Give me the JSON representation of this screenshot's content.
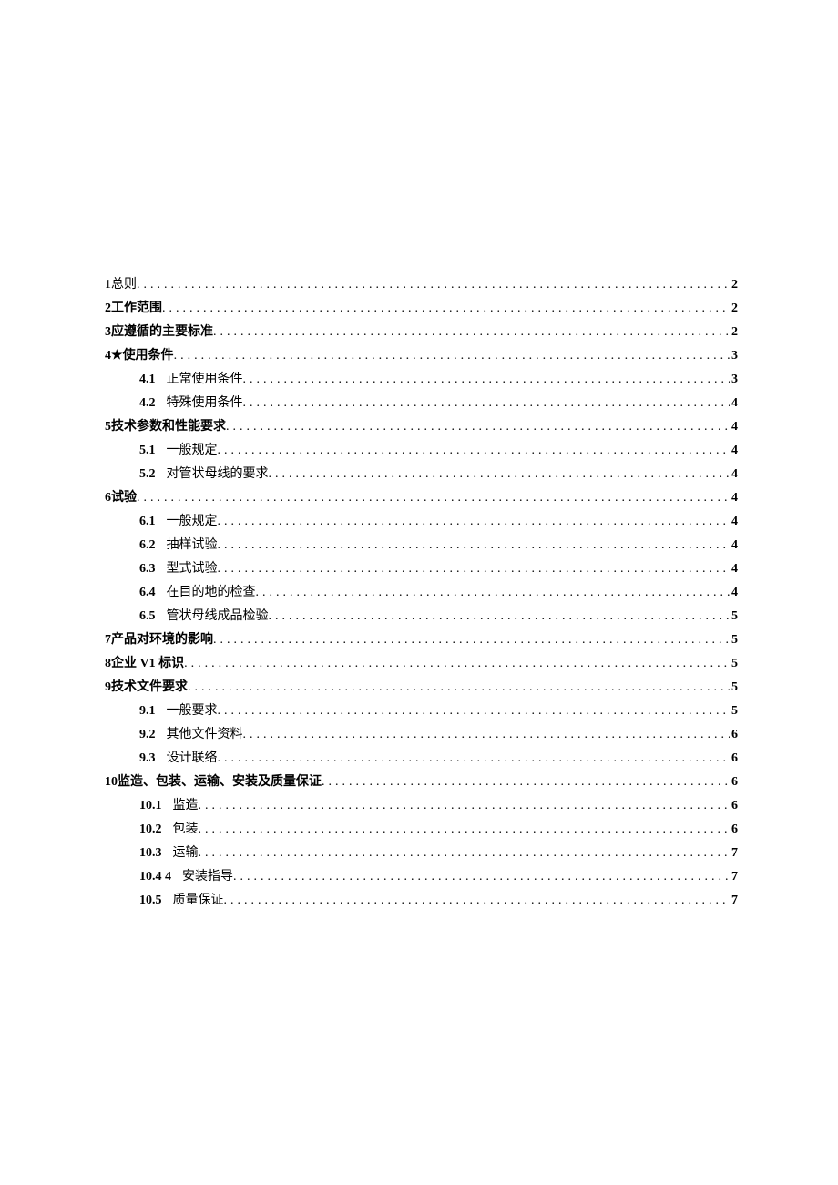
{
  "toc": [
    {
      "level": 1,
      "num": "1",
      "title": "总则",
      "page": "2",
      "bold": false
    },
    {
      "level": 1,
      "num": "2",
      "title": "工作范围",
      "page": "2",
      "bold": true
    },
    {
      "level": 1,
      "num": "3",
      "title": "应遵循的主要标准",
      "page": "2",
      "bold": true
    },
    {
      "level": 1,
      "num": "4★",
      "title": "使用条件",
      "page": "3",
      "bold": true
    },
    {
      "level": 2,
      "num": "4.1",
      "title": "正常使用条件",
      "page": "3"
    },
    {
      "level": 2,
      "num": "4.2",
      "title": "特殊使用条件",
      "page": "4"
    },
    {
      "level": 1,
      "num": "5",
      "title": "技术参数和性能要求",
      "page": "4",
      "bold": true
    },
    {
      "level": 2,
      "num": "5.1",
      "title": "一般规定",
      "page": "4"
    },
    {
      "level": 2,
      "num": "5.2",
      "title": "对管状母线的要求",
      "page": "4"
    },
    {
      "level": 1,
      "num": "6",
      "title": "试验",
      "page": "4",
      "bold": true
    },
    {
      "level": 2,
      "num": "6.1",
      "title": "一般规定",
      "page": "4"
    },
    {
      "level": 2,
      "num": "6.2",
      "title": "抽样试验",
      "page": "4"
    },
    {
      "level": 2,
      "num": "6.3",
      "title": "型式试验",
      "page": "4"
    },
    {
      "level": 2,
      "num": "6.4",
      "title": "在目的地的检查",
      "page": "4"
    },
    {
      "level": 2,
      "num": "6.5",
      "title": "管状母线成品检验",
      "page": "5"
    },
    {
      "level": 1,
      "num": "7",
      "title": "产品对环境的影响",
      "page": "5",
      "bold": true
    },
    {
      "level": 1,
      "num": "8",
      "title": "企业 V1 标识",
      "page": "5",
      "bold": true
    },
    {
      "level": 1,
      "num": "9",
      "title": "技术文件要求",
      "page": "5",
      "bold": true
    },
    {
      "level": 2,
      "num": "9.1",
      "title": "一般要求",
      "page": "5"
    },
    {
      "level": 2,
      "num": "9.2",
      "title": "其他文件资料",
      "page": "6"
    },
    {
      "level": 2,
      "num": "9.3",
      "title": "设计联络",
      "page": "6"
    },
    {
      "level": 1,
      "num": "10",
      "title": "监造、包装、运输、安装及质量保证",
      "page": "6",
      "bold": true
    },
    {
      "level": 2,
      "num": "10.1",
      "title": "监造",
      "page": "6"
    },
    {
      "level": 2,
      "num": "10.2",
      "title": "包装",
      "page": "6"
    },
    {
      "level": 2,
      "num": "10.3",
      "title": "运输",
      "page": "7"
    },
    {
      "level": 2,
      "num": "10.4 4",
      "title": "安装指导",
      "page": "7"
    },
    {
      "level": 2,
      "num": "10.5",
      "title": "质量保证",
      "page": "7"
    }
  ]
}
